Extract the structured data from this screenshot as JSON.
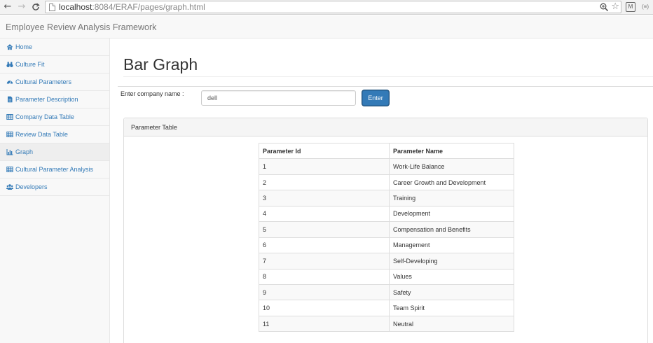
{
  "browser": {
    "url_host": "localhost",
    "url_rest": ":8084/ERAF/pages/graph.html",
    "back_glyph": "←",
    "forward_glyph": "→",
    "reload_glyph": "C",
    "zoom_glyph": "⊕",
    "star_glyph": "☆",
    "ext1_glyph": "M",
    "ext2_glyph": "(≡)"
  },
  "navbar": {
    "brand": "Employee Review Analysis Framework"
  },
  "sidebar": {
    "items": [
      {
        "label": "Home",
        "icon": "home-icon"
      },
      {
        "label": "Culture Fit",
        "icon": "binoculars-icon"
      },
      {
        "label": "Cultural Parameters",
        "icon": "tachometer-icon"
      },
      {
        "label": "Parameter Description",
        "icon": "file-icon"
      },
      {
        "label": "Company Data Table",
        "icon": "table-icon"
      },
      {
        "label": "Review Data Table",
        "icon": "table-icon"
      },
      {
        "label": "Graph",
        "icon": "bar-chart-icon",
        "active": true
      },
      {
        "label": "Cultural Parameter Analysis",
        "icon": "table-icon"
      },
      {
        "label": "Developers",
        "icon": "users-icon"
      }
    ]
  },
  "main": {
    "title": "Bar Graph",
    "company_label": "Enter company name :",
    "company_value": "dell",
    "enter_label": "Enter"
  },
  "panel": {
    "title": "Parameter Table",
    "headers": [
      "Parameter Id",
      "Parameter Name"
    ],
    "rows": [
      [
        "1",
        "Work-Life Balance"
      ],
      [
        "2",
        "Career Growth and Development"
      ],
      [
        "3",
        "Training"
      ],
      [
        "4",
        "Development"
      ],
      [
        "5",
        "Compensation and Benefits"
      ],
      [
        "6",
        "Management"
      ],
      [
        "7",
        "Self-Developing"
      ],
      [
        "8",
        "Values"
      ],
      [
        "9",
        "Safety"
      ],
      [
        "10",
        "Team Spirit"
      ],
      [
        "11",
        "Neutral"
      ]
    ]
  },
  "colors": {
    "link": "#337ab7",
    "primary_button": "#337ab7",
    "sidebar_bg": "#f8f8f8",
    "active_item_bg": "#eeeeee"
  }
}
